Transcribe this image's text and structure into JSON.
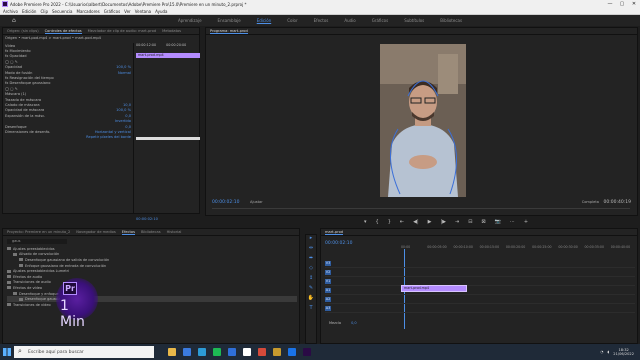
{
  "title": "Adobe Premiere Pro 2022 - C:\\Usuarios\\albert\\Documentos\\Adobe\\Premiere Pro\\15.0\\Premiere en un minuto_2.prproj *",
  "window_controls": [
    "—",
    "▢",
    "✕"
  ],
  "menu": [
    "Archivo",
    "Edición",
    "Clip",
    "Secuencia",
    "Marcadores",
    "Gráficos",
    "Ver",
    "Ventana",
    "Ayuda"
  ],
  "workspaces": [
    "Aprendizaje",
    "Ensamblaje",
    "Edición",
    "Color",
    "Efectos",
    "Audio",
    "Gráficos",
    "Subtítulos",
    "Bibliotecas"
  ],
  "active_workspace": "Edición",
  "effect_controls": {
    "tabs": [
      "Origen: (sin clips)",
      "Controles de efectos",
      "Mezclador de clip de audio: mart-prod",
      "Metadatos"
    ],
    "source": "Origen • mart-pod.mp4",
    "clip_path": "mart-prod • mart-pod.mp4",
    "section": "Vídeo",
    "rows": [
      {
        "label": "fx  Movimiento",
        "value": ""
      },
      {
        "label": "fx  Opacidad",
        "value": ""
      },
      {
        "label": "   ◯ ▢ ✎",
        "value": ""
      },
      {
        "label": "   Opacidad",
        "value": "100,0 %"
      },
      {
        "label": "   Modo de fusión",
        "value": "Normal"
      },
      {
        "label": "fx  Reasignación del tiempo",
        "value": ""
      },
      {
        "label": "fx  Desenfoque gaussiano",
        "value": ""
      },
      {
        "label": "   ◯ ▢ ✎",
        "value": ""
      },
      {
        "label": "   Máscara (1)",
        "value": ""
      },
      {
        "label": "     Trazado de máscara",
        "value": ""
      },
      {
        "label": "     Calado de máscara",
        "value": "10,0"
      },
      {
        "label": "     Opacidad de máscara",
        "value": "100,0 %"
      },
      {
        "label": "     Expansión de la másc.",
        "value": "0,0"
      },
      {
        "label": "",
        "value": "Invertido"
      },
      {
        "label": "   Desenfoque",
        "value": "0,0"
      },
      {
        "label": "   Dimensiones de desenfo.",
        "value": "Horizontal y vertical"
      },
      {
        "label": "",
        "value": "Repetir píxeles del borde"
      }
    ],
    "mini_clip": "mart-prod.mp4",
    "mini_times": [
      "00:00:12:00",
      "00:00:20:00"
    ],
    "timecode": "00:00:02:10"
  },
  "program": {
    "title": "Programa: mart-prod",
    "timecode_left": "00:00:02:10",
    "timecode_right": "00:00:40:19",
    "fit": "Ajustar",
    "quality": "Completa",
    "controls": [
      "▾",
      "{",
      "}",
      "⇤",
      "◀|",
      "▶",
      "|▶",
      "⇥",
      "⊟",
      "⊠",
      "📷",
      "⋯",
      "+"
    ]
  },
  "project": {
    "tabs": [
      "Proyecto: Premiere en un minuto_2",
      "Navegador de medios",
      "Efectos",
      "Bibliotecas",
      "Historial"
    ],
    "active_tab": "Efectos",
    "search": "gaus",
    "items": [
      {
        "label": "Ajustes preestablecidos",
        "indent": 0,
        "sel": false
      },
      {
        "label": "Alisado de convolución",
        "indent": 1,
        "sel": false
      },
      {
        "label": "Desenfoque gaussiano de salida de convolución",
        "indent": 2,
        "sel": false
      },
      {
        "label": "Enfoque gaussiano de entrada de convolución",
        "indent": 2,
        "sel": false
      },
      {
        "label": "Ajustes preestablecidos Lumetri",
        "indent": 0,
        "sel": false
      },
      {
        "label": "Efectos de audio",
        "indent": 0,
        "sel": false
      },
      {
        "label": "Transiciones de audio",
        "indent": 0,
        "sel": false
      },
      {
        "label": "Efectos de vídeo",
        "indent": 0,
        "sel": false
      },
      {
        "label": "Desenfoque y enfoque",
        "indent": 1,
        "sel": false
      },
      {
        "label": "Desenfoque gaussiano",
        "indent": 2,
        "sel": true
      },
      {
        "label": "Transiciones de vídeo",
        "indent": 0,
        "sel": false
      }
    ]
  },
  "badge": {
    "short": "Pr",
    "text": "1 Min"
  },
  "tools": [
    "▸",
    "⇹",
    "⬌",
    "◇",
    "↕",
    "✎",
    "✋",
    "T"
  ],
  "timeline": {
    "title": "mart-prod",
    "timecode": "00:00:02:10",
    "ruler": [
      "00:00",
      "00:00:05:00",
      "00:00:10:00",
      "00:00:15:00",
      "00:00:20:00",
      "00:00:25:00",
      "00:00:30:00",
      "00:00:35:00",
      "00:00:40:00"
    ],
    "tracks": [
      "V3",
      "V2",
      "V1",
      "A1",
      "A2",
      "A3"
    ],
    "mix_label": "Mezcla",
    "mix_value": "0,0",
    "clip": "mart-prod.mp4"
  },
  "taskbar": {
    "search_placeholder": "Escribe aquí para buscar",
    "time": "18:32",
    "date": "21/06/2022",
    "app_colors": [
      "#e8b84a",
      "#3b7be0",
      "#2c9bd6",
      "#1db954",
      "#2f6fd9",
      "#ffffff",
      "#d54a3a",
      "#c79a2e",
      "#1a73e8",
      "#2a0a45"
    ]
  }
}
